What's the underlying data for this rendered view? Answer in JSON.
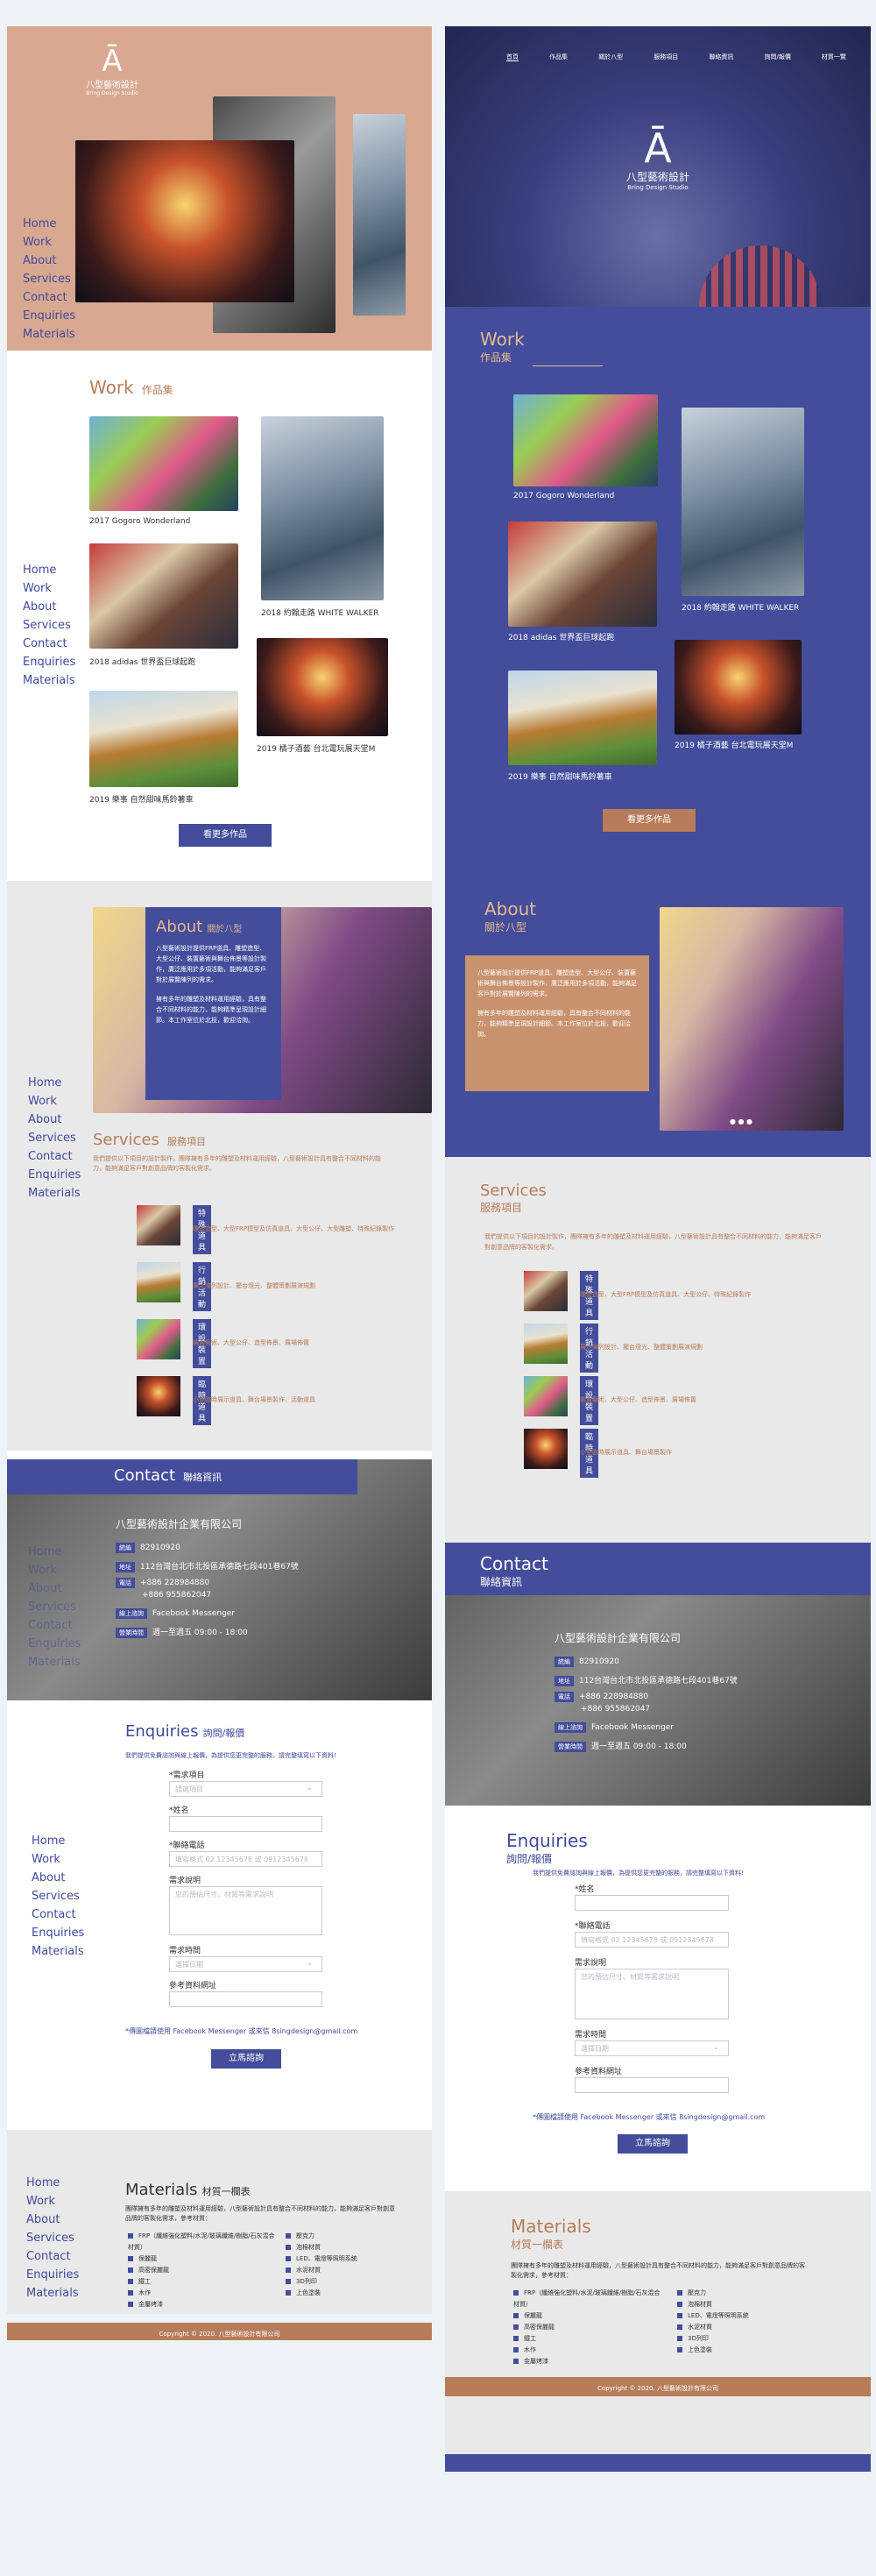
{
  "left": {
    "logo": {
      "title": "八型藝術設計",
      "subtitle": "Bring Design Studio"
    },
    "nav": [
      "Home",
      "Work",
      "About",
      "Services",
      "Contact",
      "Enquiries",
      "Materials"
    ],
    "work": {
      "title": "Work",
      "subtitle": "作品集",
      "items": [
        "2017 Gogoro Wonderland",
        "2018 約翰走路 WHITE WALKER",
        "2018 adidas 世界盃巨球起跑",
        "2019 橘子酒藝 台北電玩展天堂M",
        "2019 樂事 自然甜味馬鈴薯車"
      ],
      "more": "看更多作品"
    },
    "about": {
      "title": "About",
      "subtitle": "關於八型",
      "body": "八型藝術設計提供FRP道具、雕塑造型、大型公仔、裝置藝術與舞台佈景等設計製作，廣泛應用於多項活動，能夠滿足客戶對於展覽陳列的需求。",
      "body2": "擁有多年的雕塑及材料運用經驗，具有整合不同材料的能力，能夠精準呈現設計細節。本工作室位於北投，歡迎洽詢。"
    },
    "services": {
      "title": "Services",
      "subtitle": "服務項目",
      "intro": "我們提供以下項目的設計製作，團隊擁有多年的雕塑及材料運用經驗，八型藝術設計具有整合不同材料的能力，能夠滿足客戶對創意品牌的客製化需求。",
      "items": [
        {
          "tag": "特殊道具",
          "desc": "雕塑造型、大型FRP模型及仿真道具、大型公仔、大型雕塑、特殊紀錄製作"
        },
        {
          "tag": "行銷活動",
          "desc": "展示陳列設計、擺台燈光、整體策劃展演規劃"
        },
        {
          "tag": "環設裝置",
          "desc": "裝置藝術、大型公仔、造型佈景、展場佈置"
        },
        {
          "tag": "臨時道具",
          "desc": "小型臨時展示道具、舞台場景製作、活動道具"
        }
      ]
    },
    "contact": {
      "title": "Contact",
      "subtitle": "聯絡資訊",
      "company": "八型藝術設計企業有限公司",
      "rows": [
        {
          "label": "統編",
          "value": "82910920"
        },
        {
          "label": "地址",
          "value": "112台灣台北市北投區承德路七段401巷67號"
        },
        {
          "label": "電話",
          "value": "+886 228984880"
        },
        {
          "label": "",
          "value": "+886 955862047"
        },
        {
          "label": "線上諮詢",
          "value": "Facebook Messenger"
        },
        {
          "label": "營業時間",
          "value": "週一至週五 09:00 - 18:00"
        }
      ]
    },
    "enquiries": {
      "title": "Enquiries",
      "subtitle": "詢問/報價",
      "intro": "我們提供免費諮詢與線上報價，為提供您更完整的服務，請完整填寫以下資料!",
      "fields": [
        {
          "label": "*需求項目",
          "placeholder": "請選項目"
        },
        {
          "label": "*姓名",
          "placeholder": ""
        },
        {
          "label": "*聯絡電話",
          "placeholder": "填寫格式 02 12345678 或 0912345678"
        },
        {
          "label": "需求說明",
          "placeholder": "您的預估尺寸、材質等需求說明"
        },
        {
          "label": "需求時間",
          "placeholder": "選擇日期"
        },
        {
          "label": "參考資料網址",
          "placeholder": ""
        }
      ],
      "note": "*傳圖檔請使用 Facebook Messenger 或來信 8singdesign@gmail.com",
      "submit": "立馬諮詢"
    },
    "materials": {
      "title": "Materials",
      "subtitle": "材質一欄表",
      "intro": "團隊擁有多年的雕塑及材料運用經驗，八型藝術設計具有整合不同材料的能力，能夠滿足客戶對創意品牌的客製化需求，參考材質：",
      "col1": [
        "FRP（纖維強化塑料/水泥/玻璃纖維/樹脂/石灰混合材質）",
        "保麗龍",
        "高密保麗龍",
        "鐵工",
        "木作",
        "金屬烤漆"
      ],
      "col2": [
        "壓克力",
        "泡棉材質",
        "LED、電燈等照明系統",
        "水泥材質",
        "3D列印",
        "上色塗裝"
      ],
      "footer": "Copyright © 2020. 八型藝術設計有限公司"
    }
  },
  "right": {
    "menu": [
      "首頁",
      "作品集",
      "關於八型",
      "服務項目",
      "聯絡資訊",
      "詢問/報價",
      "材質一覽"
    ],
    "logo": {
      "title": "八型藝術設計",
      "subtitle": "Bring Design Studio"
    },
    "work": {
      "title": "Work",
      "subtitle": "作品集",
      "items": [
        "2017 Gogoro Wonderland",
        "2018 約翰走路 WHITE WALKER",
        "2018 adidas 世界盃巨球起跑",
        "2019 橘子酒藝 台北電玩展天堂M",
        "2019 樂事 自然甜味馬鈴薯車"
      ],
      "more": "看更多作品"
    },
    "about": {
      "title": "About",
      "subtitle": "關於八型",
      "body": "八型藝術設計提供FRP道具、雕塑造型、大型公仔、裝置藝術與舞台佈景等設計製作，廣泛應用於多項活動，能夠滿足客戶對於展覽陳列的需求。",
      "body2": "擁有多年的雕塑及材料運用經驗，具有整合不同材料的能力，能夠精準呈現設計細節。本工作室位於北投，歡迎洽詢。"
    },
    "services": {
      "title": "Services",
      "subtitle": "服務項目",
      "intro": "我們提供以下項目的設計製作，團隊擁有多年的雕塑及材料運用經驗，八型藝術設計具有整合不同材料的能力，能夠滿足客戶對創意品牌的客製化需求。",
      "items": [
        {
          "tag": "特殊道具",
          "desc": "雕塑造型、大型FRP模型及仿真道具、大型公仔、特殊紀錄製作"
        },
        {
          "tag": "行銷活動",
          "desc": "展示陳列設計、擺台燈光、整體策劃展演規劃"
        },
        {
          "tag": "環設裝置",
          "desc": "裝置藝術、大型公仔、造型佈景、展場佈置"
        },
        {
          "tag": "臨時道具",
          "desc": "小型臨時展示道具、舞台場景製作"
        }
      ]
    },
    "contact": {
      "title": "Contact",
      "subtitle": "聯絡資訊",
      "company": "八型藝術設計企業有限公司",
      "rows": [
        {
          "label": "統編",
          "value": "82910920"
        },
        {
          "label": "地址",
          "value": "112台灣台北市北投區承德路七段401巷67號"
        },
        {
          "label": "電話",
          "value": "+886 228984880"
        },
        {
          "label": "",
          "value": "+886 955862047"
        },
        {
          "label": "線上諮詢",
          "value": "Facebook Messenger"
        },
        {
          "label": "營業時間",
          "value": "週一至週五 09:00 - 18:00"
        }
      ]
    },
    "enquiries": {
      "title": "Enquiries",
      "subtitle": "詢問/報價",
      "intro": "我們提供免費諮詢與線上報價，為提供您更完整的服務，請完整填寫以下資料!",
      "fields": [
        {
          "label": "*姓名",
          "placeholder": ""
        },
        {
          "label": "*聯絡電話",
          "placeholder": "填寫格式 02 12345678 或 0912345678"
        },
        {
          "label": "需求說明",
          "placeholder": "您的預估尺寸、材質等需求說明"
        },
        {
          "label": "需求時間",
          "placeholder": "選擇日期"
        },
        {
          "label": "參考資料網址",
          "placeholder": ""
        }
      ],
      "note": "*傳圖檔請使用 Facebook Messenger 或來信 8singdesign@gmail.com",
      "submit": "立馬諮詢"
    },
    "materials": {
      "title": "Materials",
      "subtitle": "材質一欄表",
      "intro": "團隊擁有多年的雕塑及材料運用經驗，八型藝術設計具有整合不同材料的能力，能夠滿足客戶對創意品牌的客製化需求，參考材質：",
      "col1": [
        "FRP（纖維強化塑料/水泥/玻璃纖維/樹脂/石灰混合材質）",
        "保麗龍",
        "高密保麗龍",
        "鐵工",
        "木作",
        "金屬烤漆"
      ],
      "col2": [
        "壓克力",
        "泡棉材質",
        "LED、電燈等照明系統",
        "水泥材質",
        "3D列印",
        "上色塗裝"
      ],
      "footer": "Copyright © 2020. 八型藝術設計有限公司"
    }
  },
  "colors": {
    "brand_blue": "#434d9b",
    "brand_brown": "#b77c5a",
    "hero_tan": "#d8a890",
    "light_gray": "#e9e9e9"
  }
}
